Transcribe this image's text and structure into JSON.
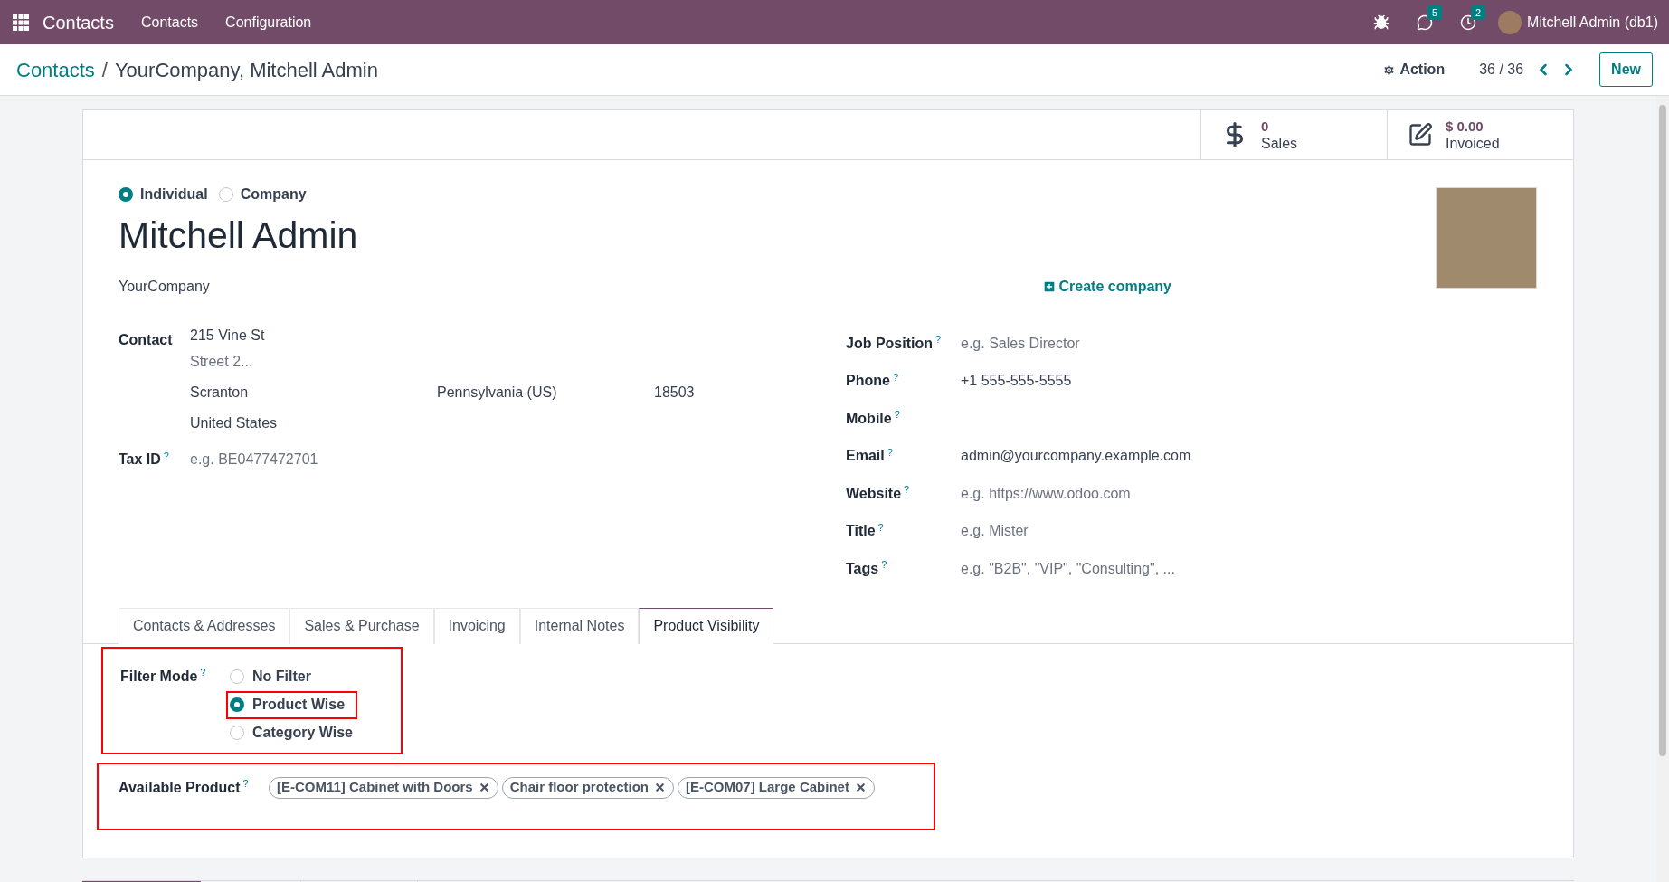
{
  "topbar": {
    "brand": "Contacts",
    "menu": [
      "Contacts",
      "Configuration"
    ],
    "notifications": [
      {
        "kind": "bug"
      },
      {
        "kind": "chat",
        "count": "5"
      },
      {
        "kind": "clock",
        "count": "2"
      }
    ],
    "user": "Mitchell Admin (db1)"
  },
  "breadcrumb": {
    "parent": "Contacts",
    "separator": "/",
    "current": "YourCompany, Mitchell Admin"
  },
  "action": "Action",
  "pager": "36 / 36",
  "new_button": "New",
  "stats": [
    {
      "kind": "dollar",
      "value": "0",
      "label": "Sales"
    },
    {
      "kind": "invoice",
      "value": "$ 0.00",
      "label": "Invoiced"
    }
  ],
  "company_type": [
    {
      "label": "Individual",
      "selected": true
    },
    {
      "label": "Company",
      "selected": false
    }
  ],
  "name": "Mitchell Admin",
  "company": "YourCompany",
  "create_company": "Create company",
  "contact": {
    "label": "Contact",
    "street": "215 Vine St",
    "street2_placeholder": "Street 2...",
    "city": "Scranton",
    "state": "Pennsylvania (US)",
    "zip": "18503",
    "country": "United States"
  },
  "tax_id": {
    "label": "Tax ID",
    "help": "?",
    "placeholder": "e.g. BE0477472701"
  },
  "right_fields": [
    {
      "label": "Job Position",
      "help": "?",
      "placeholder": "e.g. Sales Director"
    },
    {
      "label": "Phone",
      "help": "?",
      "value": "+1 555-555-5555"
    },
    {
      "label": "Mobile",
      "help": "?"
    },
    {
      "label": "Email",
      "help": "?",
      "value": "admin@yourcompany.example.com"
    },
    {
      "label": "Website",
      "help": "?",
      "placeholder": "e.g. https://www.odoo.com"
    },
    {
      "label": "Title",
      "help": "?",
      "placeholder": "e.g. Mister"
    },
    {
      "label": "Tags",
      "help": "?",
      "placeholder": "e.g. \"B2B\", \"VIP\", \"Consulting\", ..."
    }
  ],
  "tabs": [
    {
      "label": "Contacts & Addresses",
      "selected": false
    },
    {
      "label": "Sales & Purchase",
      "selected": false
    },
    {
      "label": "Invoicing",
      "selected": false
    },
    {
      "label": "Internal Notes",
      "selected": false
    },
    {
      "label": "Product Visibility",
      "selected": true
    }
  ],
  "filter_mode": {
    "label": "Filter Mode",
    "help": "?",
    "highlighted": true,
    "options": [
      {
        "label": "No Filter",
        "selected": false,
        "highlighted": false
      },
      {
        "label": "Product Wise",
        "selected": true,
        "highlighted": true
      },
      {
        "label": "Category Wise",
        "selected": false,
        "highlighted": false
      }
    ]
  },
  "available_product": {
    "label": "Available Product",
    "help": "?",
    "highlighted": true,
    "tags": [
      "[E-COM11] Cabinet with Doors",
      "Chair floor protection",
      "[E-COM07] Large Cabinet"
    ]
  }
}
